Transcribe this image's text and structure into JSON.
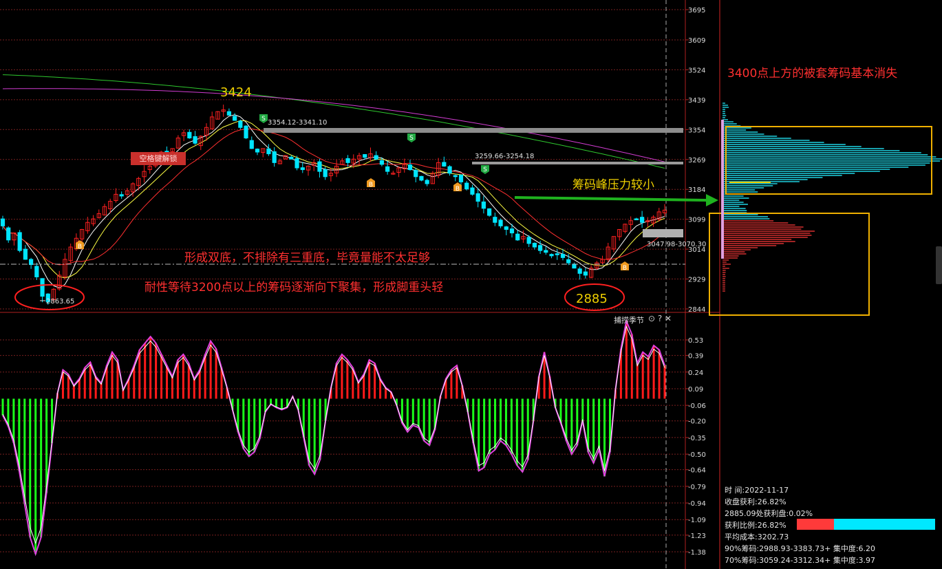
{
  "chart_data": [
    {
      "type": "candlestick",
      "title": "",
      "y_ticks": [
        "3695",
        "3609",
        "3524",
        "3439",
        "3354",
        "3269",
        "3184",
        "3099",
        "3014",
        "2929",
        "2844"
      ],
      "ylim": [
        2844,
        3695
      ],
      "markers": {
        "low_left": "2863.65",
        "resistance1": "3354.12-3341.10",
        "resistance2": "3259.66-3254.18",
        "right_range": "3047.98-3070.30"
      },
      "annotations": {
        "peak": "3424",
        "bottom": "2885",
        "chip_note": "3400点上方的被套筹码基本消失",
        "pressure_note": "筹码峰压力较小",
        "line1": "形成双底，不排除有三重底，毕竟量能不太足够",
        "line2": "耐性等待3200点以上的筹码逐渐向下聚集，形成脚重头轻"
      },
      "tooltip": "空格键解锁",
      "grid": true,
      "colors": {
        "up": "#ff2020",
        "down": "#00e5ff",
        "ma_long": "#2ec82e",
        "ma_mid": "#d23cd2",
        "ma_short": "#ffff44",
        "ma_10": "#ff3030",
        "grid": "#7a1f1f",
        "annotation_red": "#ff3030",
        "annotation_yellow": "#f0d000"
      },
      "close_series": [
        3080,
        3040,
        3060,
        3010,
        2985,
        2970,
        2935,
        2880,
        2864,
        2900,
        2940,
        2985,
        3020,
        3045,
        3070,
        3090,
        3100,
        3115,
        3135,
        3150,
        3170,
        3165,
        3180,
        3200,
        3215,
        3235,
        3250,
        3270,
        3290,
        3285,
        3300,
        3330,
        3345,
        3330,
        3315,
        3335,
        3360,
        3390,
        3405,
        3410,
        3395,
        3380,
        3360,
        3330,
        3300,
        3290,
        3300,
        3285,
        3260,
        3265,
        3280,
        3270,
        3245,
        3240,
        3250,
        3260,
        3235,
        3220,
        3230,
        3250,
        3265,
        3260,
        3270,
        3280,
        3275,
        3285,
        3270,
        3255,
        3235,
        3230,
        3245,
        3255,
        3240,
        3220,
        3210,
        3200,
        3230,
        3260,
        3250,
        3230,
        3220,
        3205,
        3185,
        3170,
        3150,
        3130,
        3110,
        3090,
        3080,
        3070,
        3060,
        3040,
        3050,
        3030,
        3020,
        3010,
        3005,
        2995,
        3000,
        2990,
        2975,
        2960,
        2945,
        2940,
        2960,
        2975,
        2985,
        3020,
        3050,
        3070,
        3085,
        3095,
        3100,
        3090,
        3095,
        3105,
        3120,
        3125
      ]
    },
    {
      "type": "bar",
      "title": "捕捞季节",
      "y_ticks": [
        "0.53",
        "0.39",
        "0.24",
        "0.09",
        "-0.06",
        "-0.20",
        "-0.35",
        "-0.50",
        "-0.64",
        "-0.79",
        "-0.94",
        "-1.09",
        "-1.23",
        "-1.38"
      ],
      "ylim": [
        -1.45,
        0.62
      ],
      "colors": {
        "pos": "#ff1a1a",
        "neg": "#1aff1a",
        "line": "#e040e0",
        "line2": "#ffffff"
      },
      "values": [
        -0.15,
        -0.25,
        -0.4,
        -0.65,
        -0.95,
        -1.25,
        -1.4,
        -1.25,
        -0.85,
        -0.4,
        0.05,
        0.26,
        0.22,
        0.12,
        0.18,
        0.28,
        0.33,
        0.2,
        0.14,
        0.3,
        0.42,
        0.35,
        0.08,
        0.18,
        0.3,
        0.44,
        0.5,
        0.56,
        0.5,
        0.4,
        0.3,
        0.2,
        0.35,
        0.4,
        0.32,
        0.18,
        0.26,
        0.4,
        0.52,
        0.45,
        0.28,
        0.1,
        -0.1,
        -0.3,
        -0.45,
        -0.52,
        -0.48,
        -0.36,
        -0.12,
        -0.05,
        -0.08,
        -0.1,
        -0.08,
        0.02,
        -0.1,
        -0.35,
        -0.6,
        -0.68,
        -0.55,
        -0.2,
        0.1,
        0.32,
        0.4,
        0.35,
        0.28,
        0.15,
        0.22,
        0.35,
        0.32,
        0.18,
        0.1,
        0.06,
        -0.06,
        -0.22,
        -0.3,
        -0.24,
        -0.26,
        -0.38,
        -0.42,
        -0.28,
        0.02,
        0.18,
        0.26,
        0.3,
        0.12,
        -0.12,
        -0.4,
        -0.65,
        -0.62,
        -0.5,
        -0.46,
        -0.38,
        -0.42,
        -0.5,
        -0.6,
        -0.66,
        -0.55,
        -0.2,
        0.2,
        0.42,
        0.2,
        -0.08,
        -0.22,
        -0.38,
        -0.5,
        -0.42,
        -0.2,
        -0.48,
        -0.58,
        -0.46,
        -0.7,
        -0.48,
        0.08,
        0.45,
        0.7,
        0.58,
        0.32,
        0.42,
        0.38,
        0.48,
        0.44,
        0.3
      ]
    }
  ],
  "info_panel": {
    "time": "时      间:2022-11-17",
    "profit": "收盘获利:26.82%",
    "profit_at": "2885.09处获利盘:0.02%",
    "ratio": "获利比例:26.82%",
    "avg_cost": "平均成本:3202.73",
    "chip90": "90%筹码:2988.93-3383.73+ 集中度:6.20",
    "chip70": "70%筹码:3059.24-3312.34+ 集中度:3.97"
  },
  "indicator_icons": "⊙ ? ✕"
}
